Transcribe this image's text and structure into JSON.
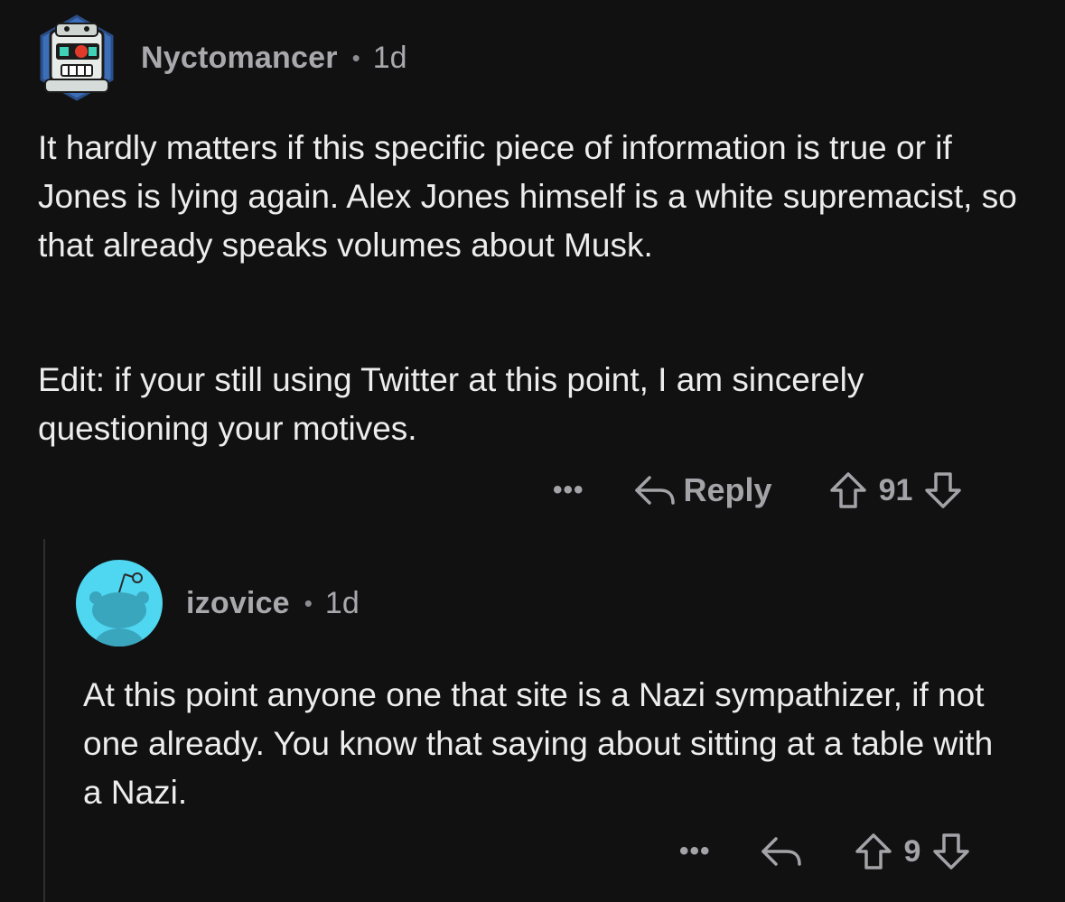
{
  "comments": [
    {
      "username": "Nyctomancer",
      "separator": "•",
      "age": "1d",
      "avatar_icon": "robot-avatar-icon",
      "paragraphs": [
        "It hardly matters if this specific piece of information is true or if Jones is lying again.  Alex Jones himself is a white supremacist, so that already speaks volumes about Musk.",
        "Edit: if your still using Twitter at this point, I am sincerely questioning your motives."
      ],
      "more_label": "•••",
      "reply_label": "Reply",
      "score": "91"
    },
    {
      "username": "izovice",
      "separator": "•",
      "age": "1d",
      "avatar_icon": "snoo-avatar-icon",
      "avatar_color": "#4fd6f0",
      "paragraphs": [
        "At this point anyone one that site is a Nazi sympathizer, if not one already.  You know that saying about sitting at a table with a Nazi."
      ],
      "more_label": "•••",
      "reply_label": "",
      "score": "9"
    }
  ]
}
